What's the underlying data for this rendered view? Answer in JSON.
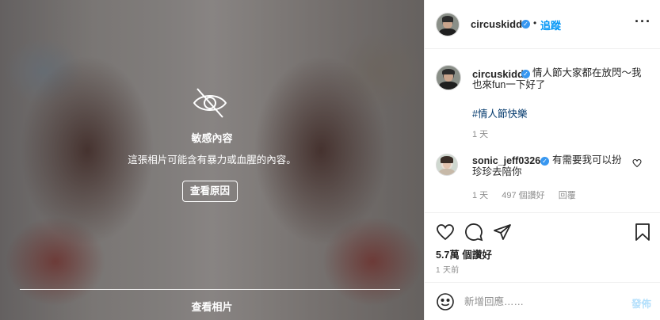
{
  "sensitive": {
    "title": "敏感內容",
    "description": "這張相片可能含有暴力或血腥的內容。",
    "why_button": "查看原因",
    "see_photo": "查看相片"
  },
  "header": {
    "username": "circuskidd",
    "separator": "•",
    "follow_label": "追蹤",
    "more_label": "···"
  },
  "caption": {
    "username": "circuskidd",
    "text": "情人節大家都在放閃～我也來fun一下好了",
    "hashtag": "#情人節快樂",
    "time": "1 天"
  },
  "comment": {
    "username": "sonic_jeff0326",
    "text": "有需要我可以扮珍珍去陪你",
    "time": "1 天",
    "likes": "497 個讚好",
    "reply": "回覆"
  },
  "stats": {
    "likes": "5.7萬 個讚好",
    "posted_ago": "1 天前"
  },
  "add_comment": {
    "placeholder": "新增回應……",
    "post_label": "發佈"
  },
  "colors": {
    "accent": "#0095f6",
    "verified": "#3897f0",
    "post_disabled": "#b2dffc",
    "muted": "#8e8e8e"
  },
  "icons": {
    "sensitive": "eye-slash-icon",
    "verified": "verified-badge-icon",
    "like": "heart-icon",
    "comment": "comment-bubble-icon",
    "share": "paper-plane-icon",
    "save": "bookmark-icon",
    "emoji": "smiley-icon"
  }
}
